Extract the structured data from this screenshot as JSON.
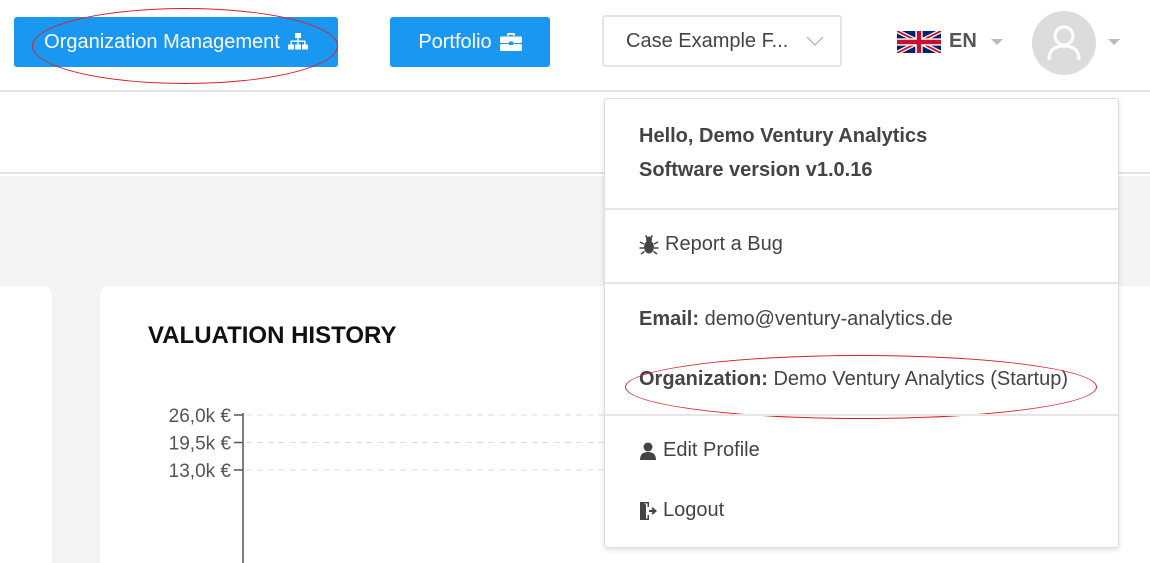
{
  "header": {
    "org_button_label": "Organization Management",
    "portfolio_button_label": "Portfolio",
    "case_select_value": "Case Example F...",
    "language": "EN"
  },
  "chart": {
    "title": "VALUATION HISTORY"
  },
  "chart_data": {
    "type": "line",
    "title": "VALUATION HISTORY",
    "xlabel": "",
    "ylabel": "",
    "y_ticks": [
      "26,0k €",
      "19,5k €",
      "13,0k €"
    ],
    "y_tick_values": [
      26000,
      19500,
      13000
    ],
    "grid": true,
    "series": []
  },
  "user_menu": {
    "greeting": "Hello, Demo Ventury Analytics",
    "version": "Software version v1.0.16",
    "report_bug": "Report a Bug",
    "email_label": "Email:",
    "email_value": "demo@ventury-analytics.de",
    "org_label": "Organization:",
    "org_value": "Demo Ventury Analytics (Startup)",
    "edit_profile": "Edit Profile",
    "logout": "Logout"
  },
  "colors": {
    "primary": "#1a97f0",
    "annotation": "#d8202a"
  }
}
